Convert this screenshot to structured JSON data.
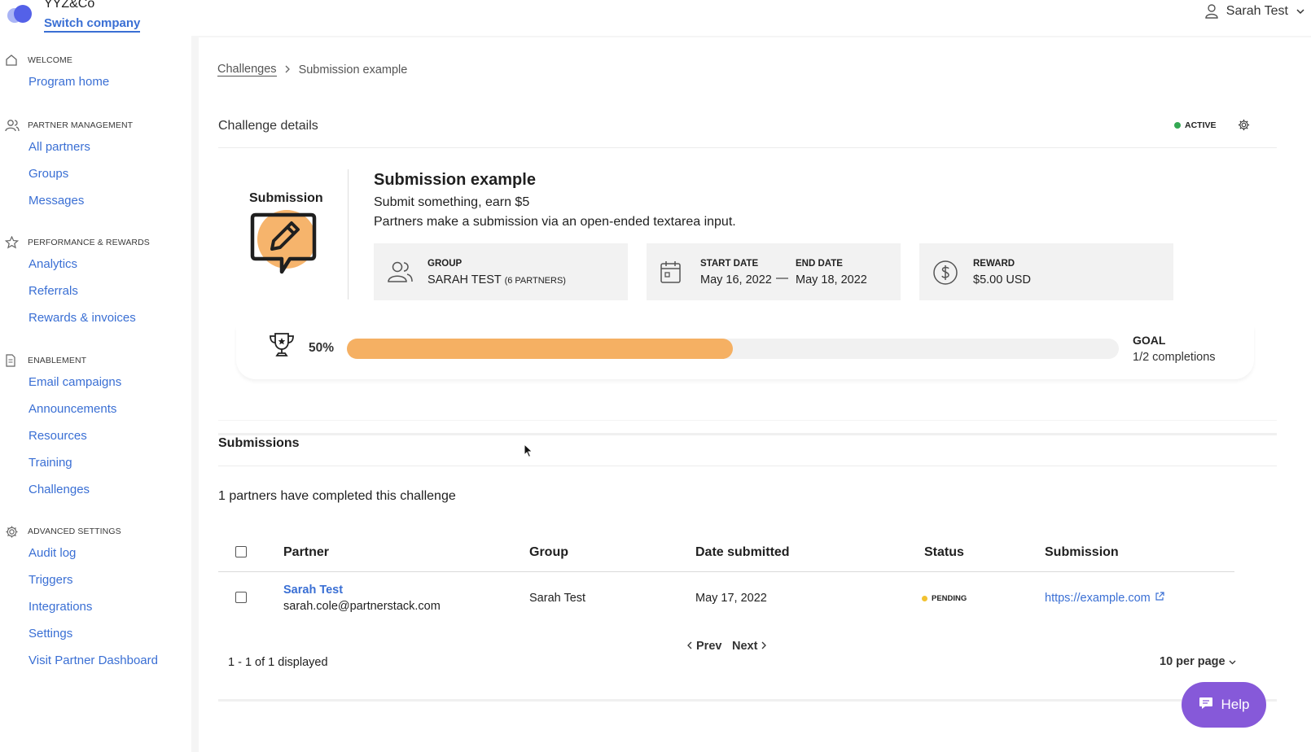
{
  "header": {
    "company": "YYZ&Co",
    "switch_company": "Switch company",
    "user_name": "Sarah Test"
  },
  "sidebar": {
    "sections": [
      {
        "title": "WELCOME",
        "icon": "home-icon",
        "items": [
          "Program home"
        ]
      },
      {
        "title": "PARTNER MANAGEMENT",
        "icon": "users-icon",
        "items": [
          "All partners",
          "Groups",
          "Messages"
        ]
      },
      {
        "title": "PERFORMANCE & REWARDS",
        "icon": "star-icon",
        "items": [
          "Analytics",
          "Referrals",
          "Rewards & invoices"
        ]
      },
      {
        "title": "ENABLEMENT",
        "icon": "document-icon",
        "items": [
          "Email campaigns",
          "Announcements",
          "Resources",
          "Training",
          "Challenges"
        ]
      },
      {
        "title": "ADVANCED SETTINGS",
        "icon": "gear-icon",
        "items": [
          "Audit log",
          "Triggers",
          "Integrations",
          "Settings",
          "Visit Partner Dashboard"
        ]
      }
    ]
  },
  "breadcrumb": {
    "parent": "Challenges",
    "current": "Submission example"
  },
  "challenge": {
    "card_title": "Challenge details",
    "status": "ACTIVE",
    "type_label": "Submission",
    "title": "Submission example",
    "subtitle": "Submit something, earn $5",
    "description": "Partners make a submission via an open-ended textarea input.",
    "group_label": "GROUP",
    "group_value": "SARAH TEST",
    "group_count": "(6 PARTNERS)",
    "start_label": "START DATE",
    "start_value": "May 16, 2022",
    "end_label": "END DATE",
    "end_value": "May 18, 2022",
    "dash": "—",
    "reward_label": "REWARD",
    "reward_value": "$5.00 USD",
    "progress_text": "50%",
    "progress_fraction": 0.5,
    "goal_label": "GOAL",
    "goal_value": "1/2 completions"
  },
  "submissions": {
    "title": "Submissions",
    "count_text": "1 partners have completed this challenge",
    "columns": [
      "Partner",
      "Group",
      "Date submitted",
      "Status",
      "Submission"
    ],
    "rows": [
      {
        "partner_name": "Sarah Test",
        "partner_email": "sarah.cole@partnerstack.com",
        "group": "Sarah Test",
        "date": "May 17, 2022",
        "status": "PENDING",
        "submission": "https://example.com"
      }
    ],
    "prev": "Prev",
    "next": "Next",
    "displayed": "1 - 1 of 1 displayed",
    "per_page": "10 per page"
  },
  "help": {
    "label": "Help"
  },
  "colors": {
    "link": "#3a6fd4",
    "progress": "#f5b063",
    "active": "#34a853",
    "pending": "#f2c230",
    "help_bg": "#8659d9"
  }
}
